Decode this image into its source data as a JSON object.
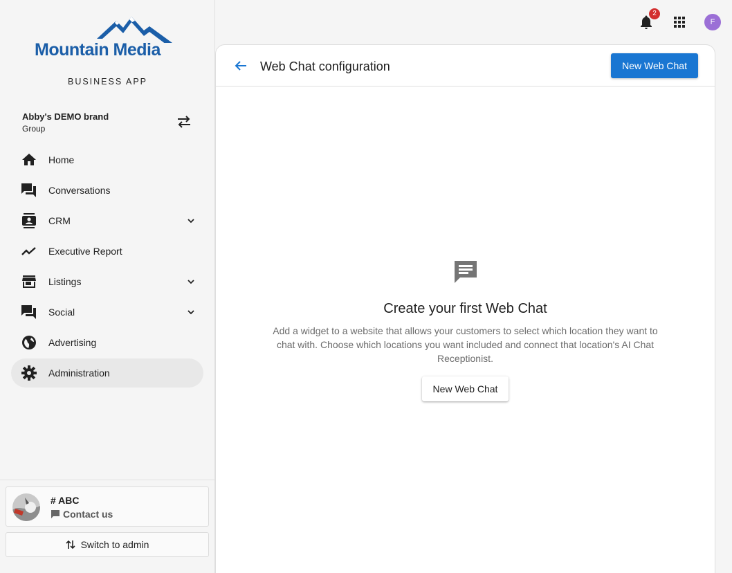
{
  "sidebar": {
    "logo_text": "Mountain Media",
    "app_label": "BUSINESS APP",
    "brand": {
      "name": "Abby's DEMO brand",
      "sub": "Group"
    },
    "items": [
      {
        "label": "Home",
        "icon": "home-icon"
      },
      {
        "label": "Conversations",
        "icon": "forum-icon"
      },
      {
        "label": "CRM",
        "icon": "contacts-icon",
        "expandable": true
      },
      {
        "label": "Executive Report",
        "icon": "trending-icon"
      },
      {
        "label": "Listings",
        "icon": "storefront-icon",
        "expandable": true
      },
      {
        "label": "Social",
        "icon": "social-icon",
        "expandable": true
      },
      {
        "label": "Advertising",
        "icon": "globe-icon"
      },
      {
        "label": "Administration",
        "icon": "gear-icon",
        "active": true
      }
    ],
    "contact": {
      "name": "# ABC",
      "action": "Contact us"
    },
    "switch_admin": "Switch to admin"
  },
  "topbar": {
    "notification_count": "2",
    "user_initial": "F"
  },
  "main": {
    "title": "Web Chat configuration",
    "primary_button": "New Web Chat",
    "empty": {
      "title": "Create your first Web Chat",
      "description": "Add a widget to a website that allows your customers to select which location they want to chat with. Choose which locations you want included and connect that location's AI Chat Receptionist.",
      "button": "New Web Chat"
    }
  },
  "colors": {
    "primary": "#1976d2",
    "logo": "#1b5ea8",
    "badge": "#d32f2f",
    "avatar": "#9b6fd6"
  }
}
